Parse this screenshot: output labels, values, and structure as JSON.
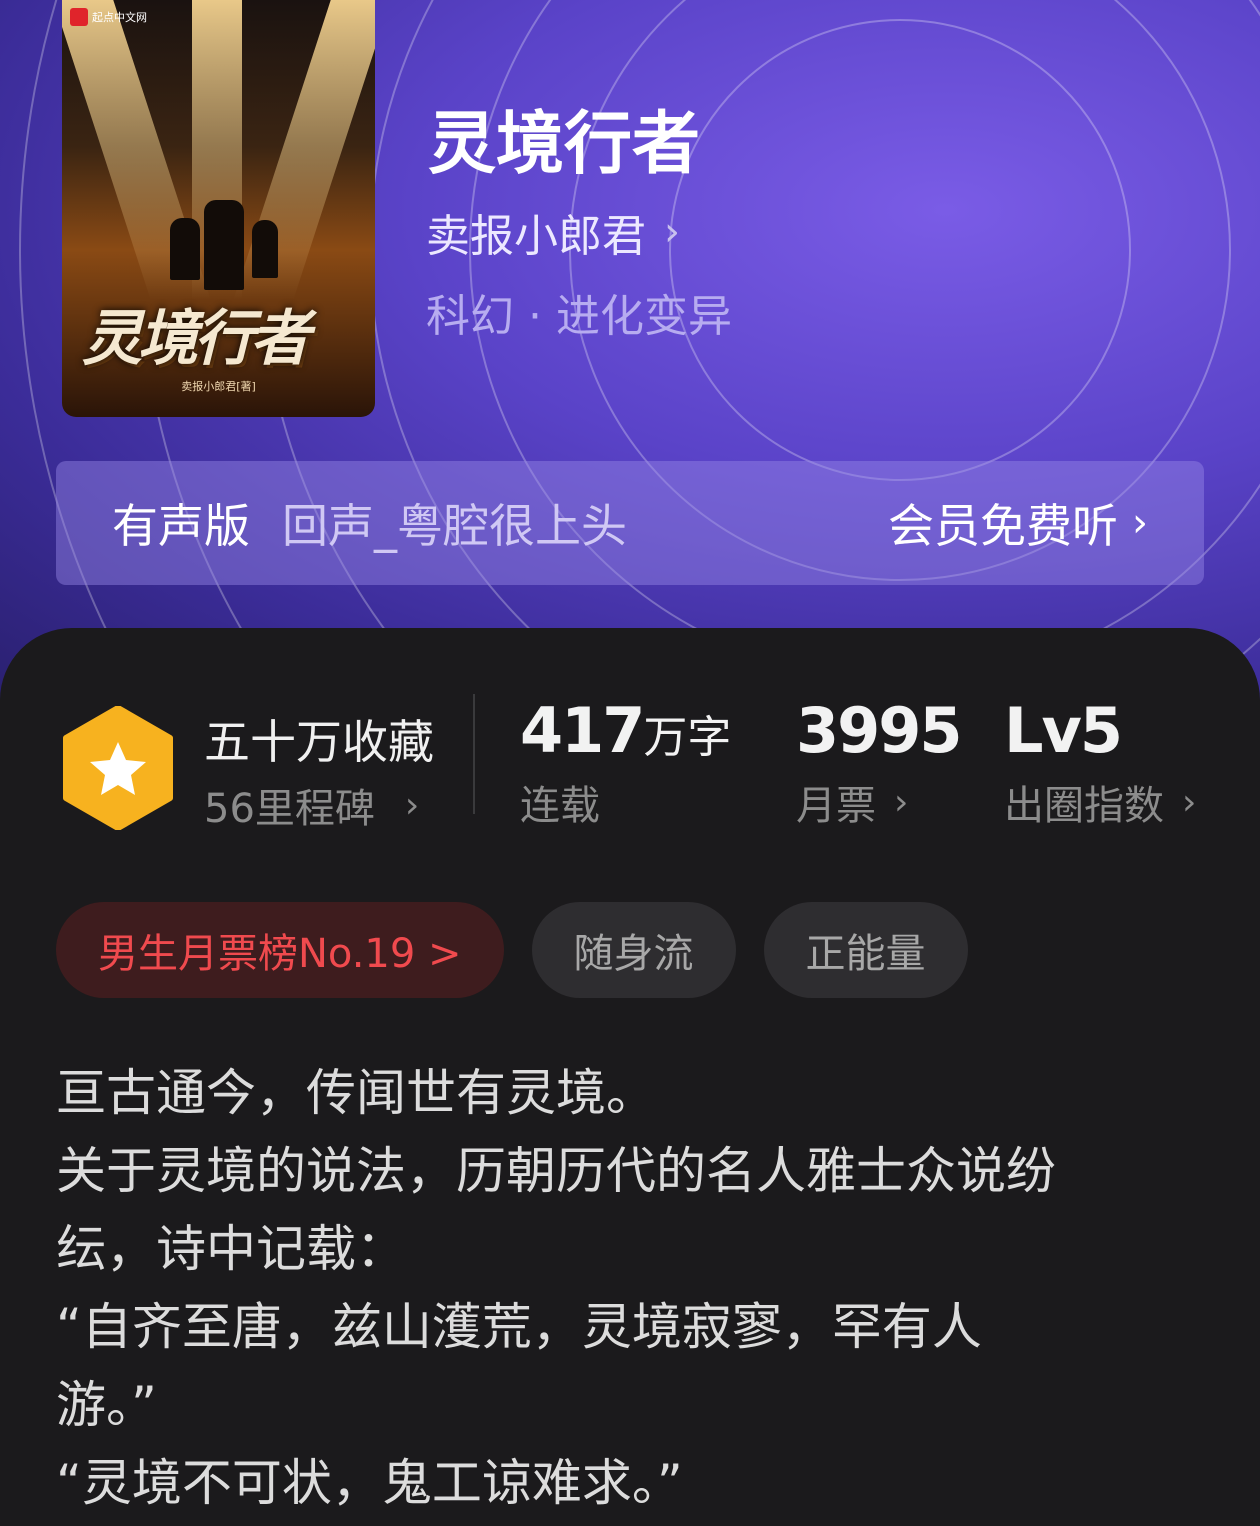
{
  "book": {
    "title": "灵境行者",
    "author": "卖报小郎君",
    "genre": "科幻 · 进化变异",
    "cover": {
      "publisher": "起点中文网",
      "title_art": "灵境行者",
      "author_line": "卖报小郎君[著]"
    }
  },
  "audio": {
    "label": "有声版",
    "narrator": "回声_粤腔很上头",
    "cta": "会员免费听"
  },
  "stats": {
    "favorites": {
      "title": "五十万收藏",
      "sub": "56里程碑"
    },
    "words": {
      "num": "417",
      "unit": "万字",
      "label": "连载"
    },
    "tickets": {
      "num": "3995",
      "label": "月票"
    },
    "index": {
      "num": "Lv5",
      "label": "出圈指数"
    }
  },
  "tags": [
    {
      "label": "男生月票榜No.19 >"
    },
    {
      "label": "随身流"
    },
    {
      "label": "正能量"
    }
  ],
  "synopsis": [
    "亘古通今，传闻世有灵境。",
    "关于灵境的说法，历朝历代的名人雅士众说纷",
    "纭，诗中记载：",
    "“自齐至唐，兹山濩荒，灵境寂寥，罕有人",
    "游。”",
    "“灵境不可状，鬼工谅难求。”"
  ],
  "icons": {
    "chevron": "chevron-right-icon",
    "badge": "star-hexagon-icon"
  },
  "colors": {
    "hero_purple": "#5a43c8",
    "rank_red": "#f04a4e",
    "badge_gold": "#f7b21f"
  }
}
